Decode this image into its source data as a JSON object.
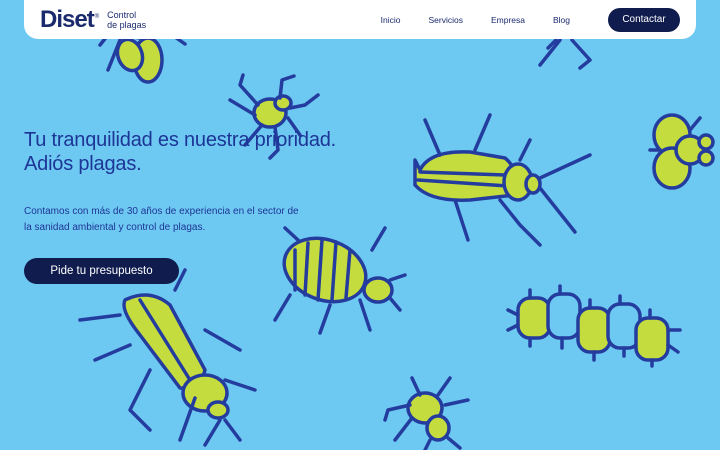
{
  "brand": {
    "name": "Diset",
    "reg_mark": "®",
    "tagline_line1": "Control",
    "tagline_line2": "de plagas"
  },
  "nav": {
    "items": [
      {
        "label": "Inicio"
      },
      {
        "label": "Servicios"
      },
      {
        "label": "Empresa"
      },
      {
        "label": "Blog"
      }
    ],
    "cta_label": "Contactar"
  },
  "hero": {
    "title_line1": "Tu tranquilidad es nuestra prioridad.",
    "title_line2": "Adiós plagas.",
    "desc_line1": "Contamos con más de 30 años de experiencia en el sector de",
    "desc_line2": "la sanidad ambiental y control de plagas.",
    "button_label": "Pide tu presupuesto"
  },
  "colors": {
    "background": "#6ec9f2",
    "bug_fill": "#c5dc3f",
    "bug_outline": "#243c9e",
    "button_dark": "#0f1c4d"
  },
  "illustrations": [
    "fly-icon",
    "spider-icon",
    "cockroach-icon",
    "bedbug-icon",
    "caterpillar-icon",
    "wasp-icon"
  ]
}
